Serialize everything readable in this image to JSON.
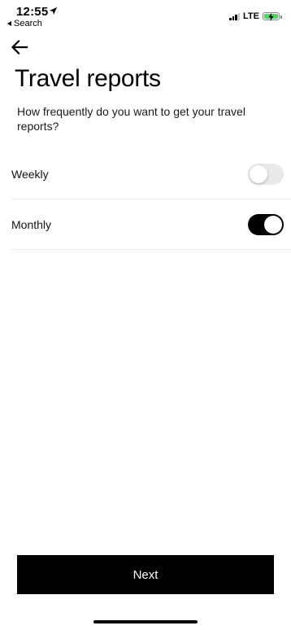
{
  "status_bar": {
    "time": "12:55",
    "back_to_app": "Search",
    "network": "LTE",
    "battery_color": "#4cd964",
    "icons": [
      "location-arrow-icon",
      "signal-icon",
      "battery-charging-icon"
    ]
  },
  "nav": {
    "back_icon": "arrow-left-icon"
  },
  "page": {
    "title": "Travel reports",
    "subtitle": "How frequently do you want to get your travel reports?"
  },
  "options": [
    {
      "label": "Weekly",
      "enabled": false
    },
    {
      "label": "Monthly",
      "enabled": true
    }
  ],
  "footer": {
    "next_label": "Next",
    "button_color": "#000000"
  }
}
